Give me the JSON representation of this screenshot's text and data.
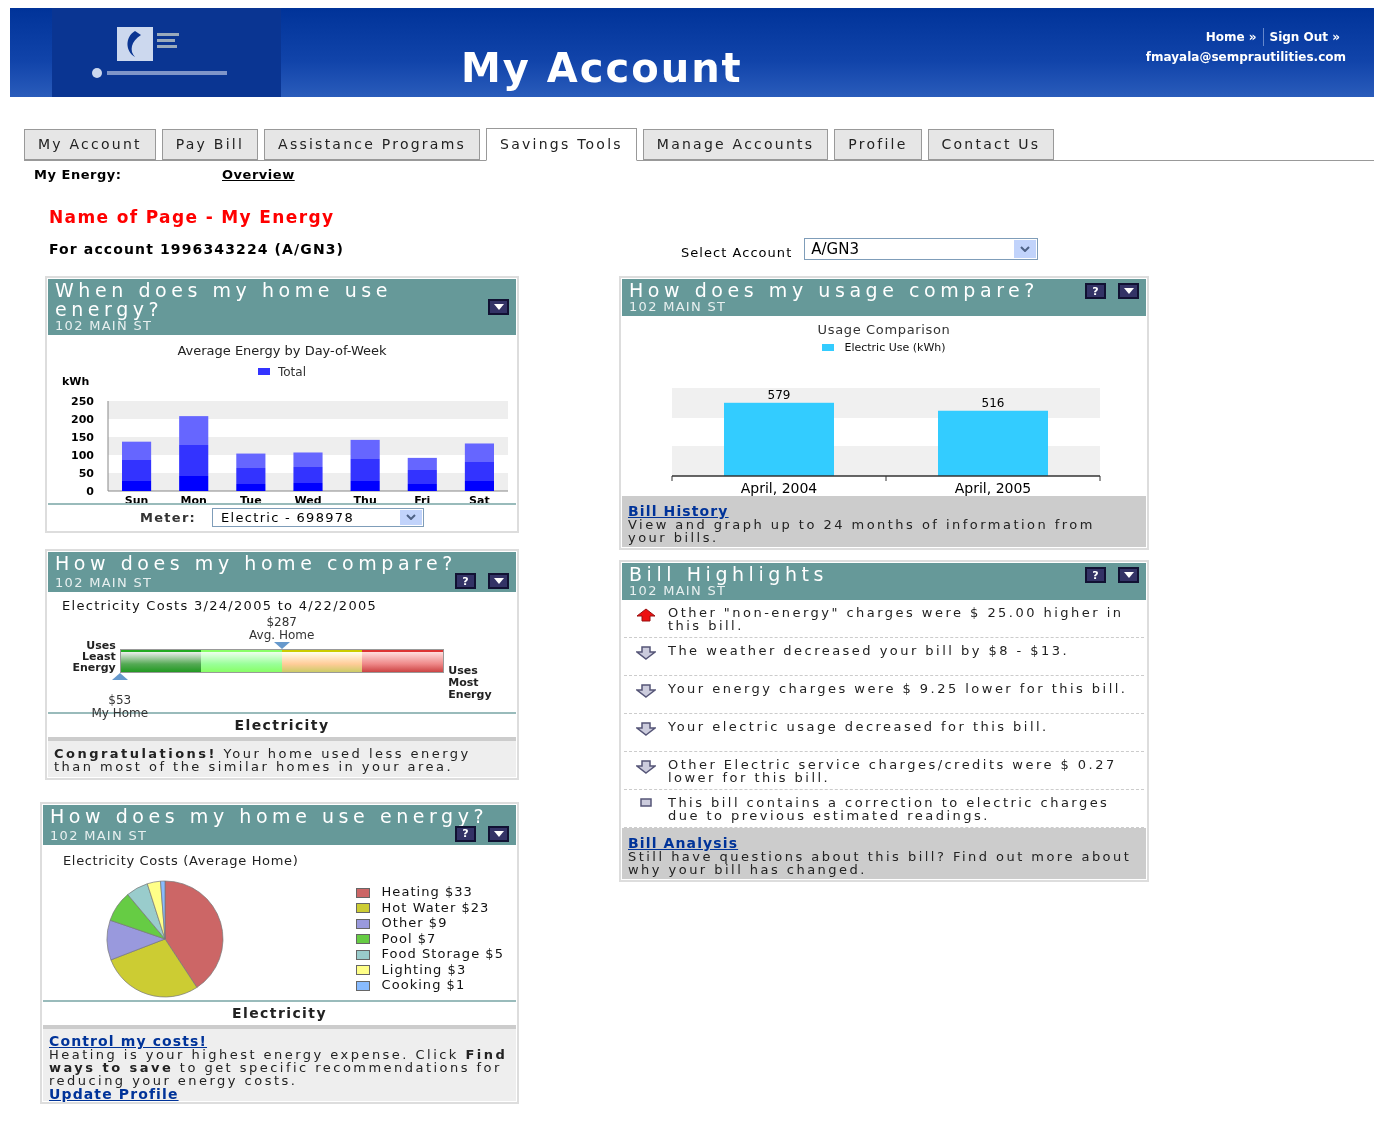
{
  "header": {
    "title": "My Account",
    "links": [
      "Home »",
      "Sign Out »"
    ],
    "email": "fmayala@semprautilities.com"
  },
  "tabs": [
    {
      "label": "My Account",
      "selected": false
    },
    {
      "label": "Pay Bill",
      "selected": false
    },
    {
      "label": "Assistance Programs",
      "selected": false
    },
    {
      "label": "Savings Tools",
      "selected": true
    },
    {
      "label": "Manage Accounts",
      "selected": false
    },
    {
      "label": "Profile",
      "selected": false
    },
    {
      "label": "Contact Us",
      "selected": false
    }
  ],
  "subnav": {
    "label": "My Energy:",
    "link": "Overview"
  },
  "page_title": "Name of Page - My Energy",
  "account_line": "For account 1996343224 (A/GN3)",
  "select_account": {
    "label": "Select Account",
    "value": "A/GN3"
  },
  "day_panel": {
    "title": "When does my home use energy?",
    "address": "102 MAIN ST",
    "buttons": [
      {
        "kind": "collapse"
      }
    ],
    "chart_data": {
      "type": "bar",
      "title": "Average Energy by Day-of-Week",
      "ylabel": "kWh",
      "categories": [
        "Sun",
        "Mon",
        "Tue",
        "Wed",
        "Thu",
        "Fri",
        "Sat"
      ],
      "series": [
        {
          "name": "Total",
          "color": "#3333ff",
          "values": [
            137,
            208,
            104,
            107,
            142,
            92,
            132
          ]
        }
      ],
      "ylim": [
        0,
        250
      ],
      "yticks": [
        0,
        50,
        100,
        150,
        200,
        250
      ]
    },
    "meter": {
      "label": "Meter:",
      "value": "Electric - 698978"
    }
  },
  "compare_panel": {
    "title": "How does my home compare?",
    "address": "102 MAIN ST",
    "buttons": [
      {
        "kind": "help",
        "label": "?"
      },
      {
        "kind": "collapse"
      }
    ],
    "gauge_title": "Electricity Costs 3/24/2005 to 4/22/2005",
    "left_label": "Uses Least Energy",
    "right_label": "Uses Most Energy",
    "markers": [
      {
        "kind": "above",
        "value": "$287",
        "label": "Avg. Home"
      },
      {
        "kind": "below",
        "value": "$53",
        "label": "My Home"
      }
    ],
    "section": "Electricity",
    "message": "**Congratulations!** Your home used less energy than most of the similar homes in your area."
  },
  "use_panel": {
    "title": "How does my home use energy?",
    "address": "102 MAIN ST",
    "buttons": [
      {
        "kind": "help",
        "label": "?"
      },
      {
        "kind": "collapse"
      }
    ],
    "chart_data": {
      "type": "pie",
      "title": "Electricity Costs (Average Home)",
      "categories": [
        "Heating $33",
        "Hot Water $23",
        "Other $9",
        "Pool $7",
        "Food Storage $5",
        "Lighting $3",
        "Cooking $1"
      ],
      "values": [
        33,
        23,
        9,
        7,
        5,
        3,
        1
      ],
      "legend": "right",
      "colors": [
        "#cc6666",
        "#cccc33",
        "#9999dd",
        "#66cc44",
        "#99cccc",
        "#ffff88",
        "#88bbff"
      ]
    },
    "section": "Electricity",
    "link": "Control my costs!",
    "text": "Heating is your highest energy expense. Click **Find ways to save** to get specific recommendations for reducing your energy costs.",
    "link2": "Update Profile"
  },
  "usage_panel": {
    "title": "How does my usage compare?",
    "address": "102 MAIN ST",
    "buttons": [
      {
        "kind": "help",
        "label": "?"
      },
      {
        "kind": "collapse"
      }
    ],
    "chart_data": {
      "type": "bar",
      "title": "Usage Comparison",
      "categories": [
        "April, 2004",
        "April, 2005"
      ],
      "series": [
        {
          "name": "Electric Use (kWh)",
          "color": "#33ccff",
          "values": [
            579,
            516
          ]
        }
      ],
      "data_labels": true
    },
    "link": "Bill History",
    "text": "View and graph up to 24 months of information from your bills."
  },
  "bill_panel": {
    "title": "Bill Highlights",
    "address": "102 MAIN ST",
    "buttons": [
      {
        "kind": "help",
        "label": "?"
      },
      {
        "kind": "collapse"
      }
    ],
    "items": [
      {
        "kind": "up",
        "text": "Other \"non-energy\" charges were $ 25.00 higher in this bill."
      },
      {
        "kind": "down",
        "text": "The weather decreased your bill by $8 - $13."
      },
      {
        "kind": "down",
        "text": "Your energy charges were $ 9.25 lower for this bill."
      },
      {
        "kind": "down",
        "text": "Your electric usage decreased for this bill."
      },
      {
        "kind": "down",
        "text": "Other Electric service charges/credits were $ 0.27 lower for this bill."
      },
      {
        "kind": "note",
        "text": "This bill contains a correction to electric charges due to previous estimated readings."
      }
    ],
    "link": "Bill Analysis",
    "text": "Still have questions about this bill? Find out more about why your bill has changed."
  }
}
